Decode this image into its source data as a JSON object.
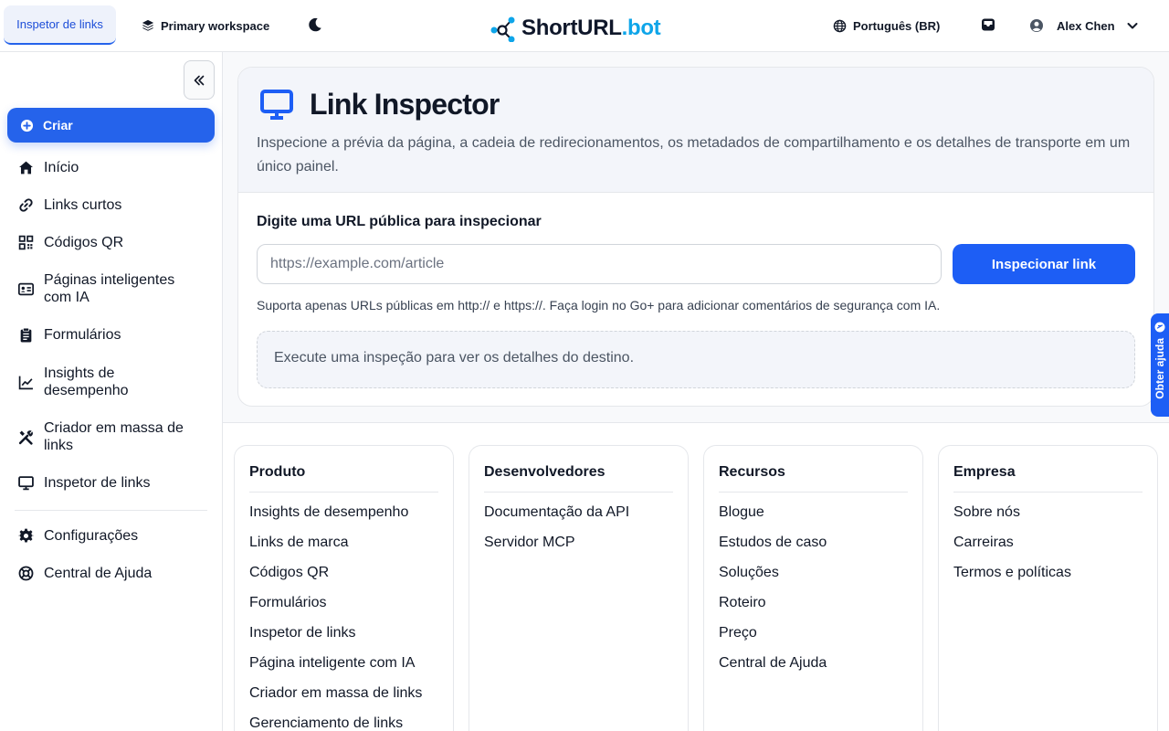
{
  "topbar": {
    "active_tab": "Inspetor de links",
    "workspace": "Primary workspace",
    "logo_main": "ShortURL",
    "logo_suffix": ".bot",
    "language": "Português (BR)",
    "user_name": "Alex Chen"
  },
  "sidebar": {
    "create_label": "Criar",
    "items": [
      {
        "label": "Início",
        "icon": "home-icon"
      },
      {
        "label": "Links curtos",
        "icon": "link-icon"
      },
      {
        "label": "Códigos QR",
        "icon": "qr-code-icon"
      },
      {
        "label": "Páginas inteligentes com IA",
        "icon": "id-card-icon"
      },
      {
        "label": "Formulários",
        "icon": "clipboard-icon"
      },
      {
        "label": "Insights de desempenho",
        "icon": "chart-line-icon"
      },
      {
        "label": "Criador em massa de links",
        "icon": "tools-icon"
      },
      {
        "label": "Inspetor de links",
        "icon": "monitor-icon"
      }
    ],
    "bottom_items": [
      {
        "label": "Configurações",
        "icon": "gear-icon"
      },
      {
        "label": "Central de Ajuda",
        "icon": "life-ring-icon"
      }
    ]
  },
  "inspector": {
    "title": "Link Inspector",
    "description": "Inspecione a prévia da página, a cadeia de redirecionamentos, os metadados de compartilhamento e os detalhes de transporte em um único painel.",
    "field_label": "Digite uma URL pública para inspecionar",
    "input_placeholder": "https://example.com/article",
    "input_value": "",
    "button_label": "Inspecionar link",
    "hint": "Suporta apenas URLs públicas em http:// e https://. Faça login no Go+ para adicionar comentários de segurança com IA.",
    "empty_state": "Execute uma inspeção para ver os detalhes do destino."
  },
  "help_tab": "Obter ajuda",
  "footer": {
    "columns": [
      {
        "title": "Produto",
        "links": [
          "Insights de desempenho",
          "Links de marca",
          "Códigos QR",
          "Formulários",
          "Inspetor de links",
          "Página inteligente com IA",
          "Criador em massa de links",
          "Gerenciamento de links"
        ]
      },
      {
        "title": "Desenvolvedores",
        "links": [
          "Documentação da API",
          "Servidor MCP"
        ]
      },
      {
        "title": "Recursos",
        "links": [
          "Blogue",
          "Estudos de caso",
          "Soluções",
          "Roteiro",
          "Preço",
          "Central de Ajuda"
        ]
      },
      {
        "title": "Empresa",
        "links": [
          "Sobre nós",
          "Carreiras",
          "Termos e políticas"
        ]
      }
    ]
  },
  "colors": {
    "accent": "#1d5ef5",
    "logo_suffix": "#0ea5e9"
  }
}
